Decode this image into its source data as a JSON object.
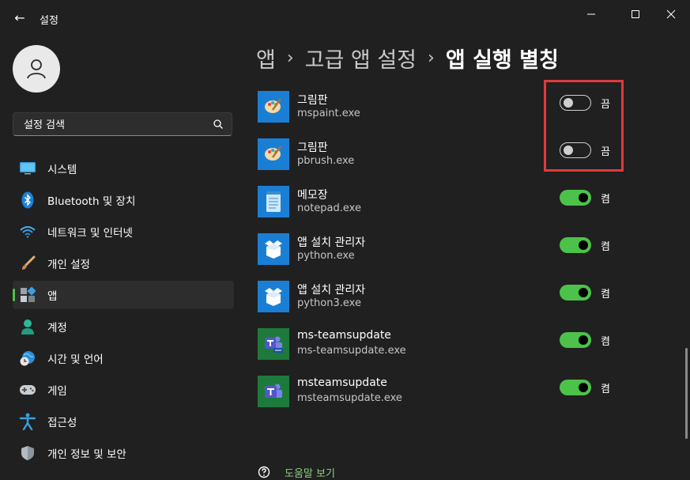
{
  "window": {
    "title": "설정",
    "back_glyph": "←"
  },
  "sidebar": {
    "search_placeholder": "설정 검색",
    "items": [
      {
        "label": "시스템",
        "icon": "monitor-icon"
      },
      {
        "label": "Bluetooth 및 장치",
        "icon": "bluetooth-icon"
      },
      {
        "label": "네트워크 및 인터넷",
        "icon": "wifi-icon"
      },
      {
        "label": "개인 설정",
        "icon": "brush-icon"
      },
      {
        "label": "앱",
        "icon": "apps-icon",
        "active": true
      },
      {
        "label": "계정",
        "icon": "person-icon"
      },
      {
        "label": "시간 및 언어",
        "icon": "globe-clock-icon"
      },
      {
        "label": "게임",
        "icon": "gamepad-icon"
      },
      {
        "label": "접근성",
        "icon": "accessibility-icon"
      },
      {
        "label": "개인 정보 및 보안",
        "icon": "shield-icon"
      }
    ]
  },
  "breadcrumb": {
    "items": [
      "앱",
      "고급 앱 설정"
    ],
    "separator": "›",
    "current": "앱 실행 별칭"
  },
  "apps": [
    {
      "name": "그림판",
      "exe": "mspaint.exe",
      "enabled": false,
      "state_label": "끔",
      "icon": "paint-icon"
    },
    {
      "name": "그림판",
      "exe": "pbrush.exe",
      "enabled": false,
      "state_label": "끔",
      "icon": "paint-icon"
    },
    {
      "name": "메모장",
      "exe": "notepad.exe",
      "enabled": true,
      "state_label": "켬",
      "icon": "notepad-icon"
    },
    {
      "name": "앱 설치 관리자",
      "exe": "python.exe",
      "enabled": true,
      "state_label": "켬",
      "icon": "app-installer-icon"
    },
    {
      "name": "앱 설치 관리자",
      "exe": "python3.exe",
      "enabled": true,
      "state_label": "켬",
      "icon": "app-installer-icon"
    },
    {
      "name": "ms-teamsupdate",
      "exe": "ms-teamsupdate.exe",
      "enabled": true,
      "state_label": "켬",
      "icon": "teams-new-icon"
    },
    {
      "name": "msteamsupdate",
      "exe": "msteamsupdate.exe",
      "enabled": true,
      "state_label": "켬",
      "icon": "teams-icon"
    }
  ],
  "help": {
    "label": "도움말 보기"
  },
  "colors": {
    "background": "#202020",
    "accent": "#4cc24a",
    "highlight_box": "#e0393e",
    "help_link": "#8bd17c"
  }
}
